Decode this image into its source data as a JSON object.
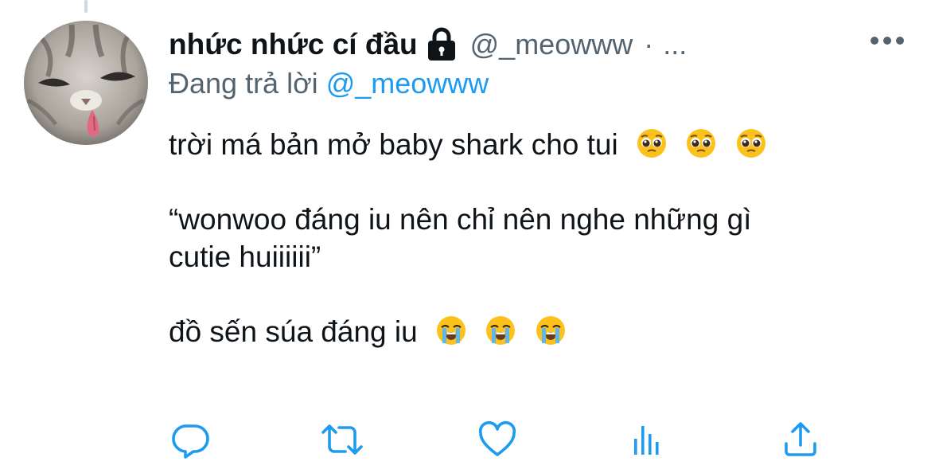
{
  "tweet": {
    "display_name": "nhức nhức cí đầu",
    "handle": "@_meowww",
    "separator": "·",
    "timestamp": "...",
    "reply_prefix": "Đang trả lời",
    "reply_handle": "@_meowww",
    "lines": [
      "trời má bản mở baby shark cho tui",
      "“wonwoo đáng iu nên chỉ nên nghe những gì",
      "cutie huiiiiii”",
      "đồ sến súa đáng iu"
    ],
    "emoji_groups": [
      {
        "name": "pleading-face",
        "count": 3
      },
      {
        "name": "loudly-crying-face",
        "count": 3
      }
    ]
  },
  "icons": {
    "lock": "lock-icon",
    "more": "more-icon",
    "reply": "reply-icon",
    "retweet": "retweet-icon",
    "like": "heart-icon",
    "analytics": "analytics-icon",
    "share": "share-icon"
  },
  "colors": {
    "text": "#0f1419",
    "muted": "#536471",
    "link": "#1d9bf0",
    "icon": "#1d9bf0"
  }
}
